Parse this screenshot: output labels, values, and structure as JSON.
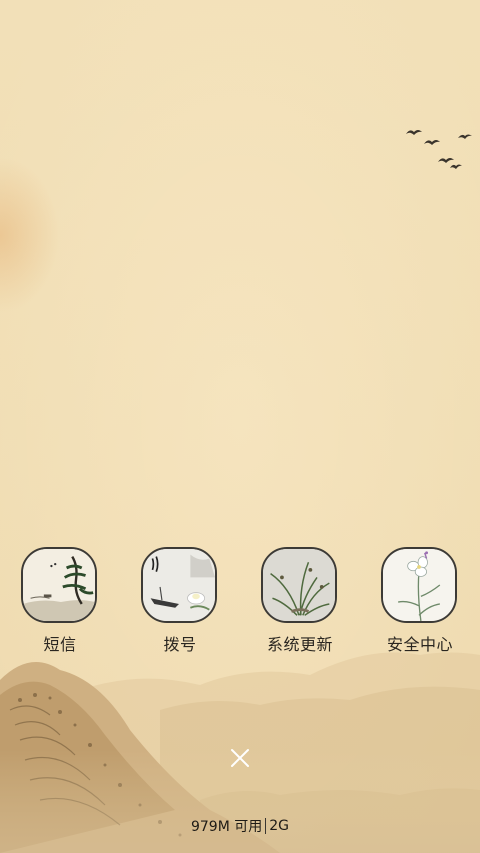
{
  "dock": {
    "apps": [
      {
        "label": "短信",
        "icon": "ink-landscape-pine-icon"
      },
      {
        "label": "拨号",
        "icon": "ink-boat-lotus-icon"
      },
      {
        "label": "系统更新",
        "icon": "ink-orchid-icon"
      },
      {
        "label": "安全中心",
        "icon": "ink-magnolia-icon"
      }
    ]
  },
  "status": {
    "memory": "979M 可用",
    "network": "2G"
  },
  "close_button": {
    "icon": "close-icon"
  },
  "colors": {
    "background": "#f1dfb6",
    "icon_border": "#3c3a36",
    "text": "#2a2620"
  }
}
